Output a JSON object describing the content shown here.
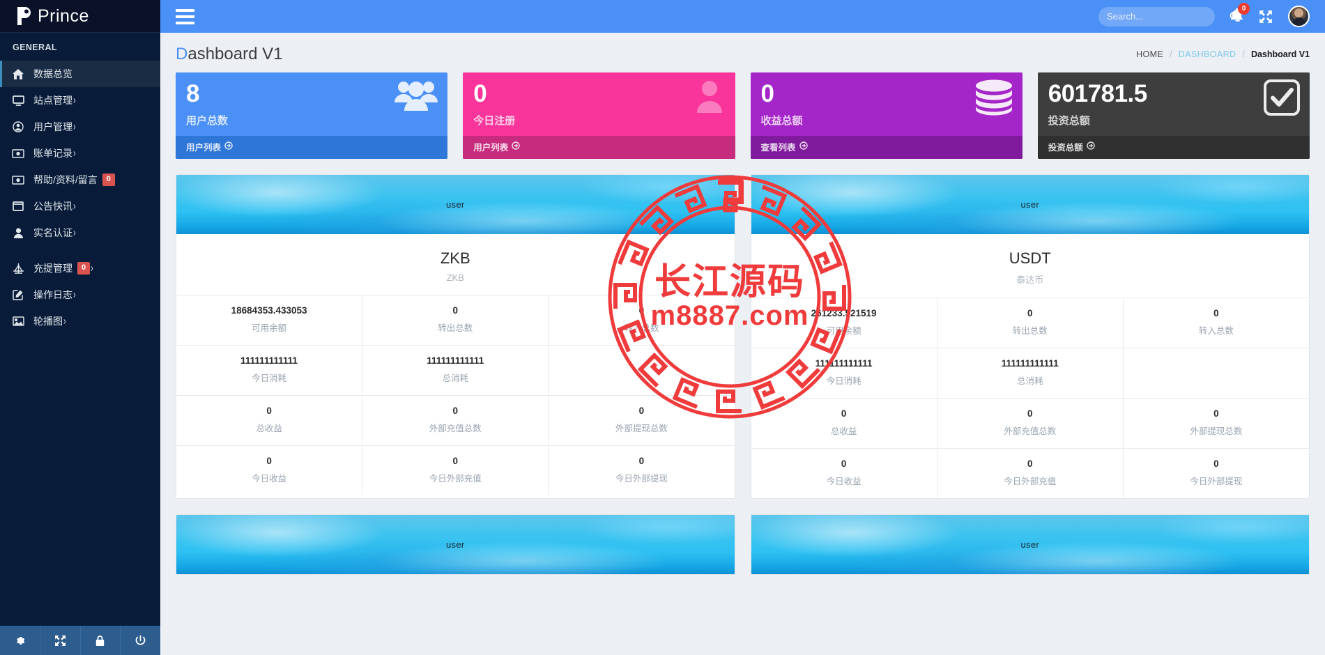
{
  "brand": {
    "name": "Prince",
    "logo_icon": "p-logo-icon"
  },
  "sidebar": {
    "section_label": "GENERAL",
    "items": [
      {
        "label": "数据总览",
        "icon": "home-icon",
        "arrow": "",
        "badge": "",
        "active": true
      },
      {
        "label": "站点管理",
        "icon": "monitor-icon",
        "arrow": "›",
        "badge": "",
        "active": false
      },
      {
        "label": "用户管理",
        "icon": "user-circle-icon",
        "arrow": "›",
        "badge": "",
        "active": false
      },
      {
        "label": "账单记录",
        "icon": "money-icon",
        "arrow": "›",
        "badge": "",
        "active": false
      },
      {
        "label": "帮助/资料/留言",
        "icon": "money-icon",
        "arrow": "",
        "badge": "0",
        "active": false
      },
      {
        "label": "公告快讯",
        "icon": "window-icon",
        "arrow": "›",
        "badge": "",
        "active": false
      },
      {
        "label": "实名认证",
        "icon": "person-icon",
        "arrow": "›",
        "badge": "",
        "active": false
      },
      {
        "label": "充提管理",
        "icon": "balance-scale-icon",
        "arrow": "›",
        "badge": "0",
        "active": false
      },
      {
        "label": "操作日志",
        "icon": "edit-square-icon",
        "arrow": "›",
        "badge": "",
        "active": false
      },
      {
        "label": "轮播图",
        "icon": "image-icon",
        "arrow": "›",
        "badge": "",
        "active": false
      }
    ],
    "footer_icons": [
      "gear-icon",
      "expand-arrows-icon",
      "lock-icon",
      "power-icon"
    ]
  },
  "header": {
    "menu_icon": "hamburger-icon",
    "search": {
      "placeholder": "Search...",
      "value": "",
      "icon": "search-icon"
    },
    "bell": {
      "icon": "bell-icon",
      "badge": "0"
    },
    "fullscreen_icon": "expand-arrows-icon",
    "avatar": "user-avatar"
  },
  "page": {
    "title_first": "D",
    "title_rest": "ashboard V1",
    "breadcrumb": {
      "home": "HOME",
      "sep": "/",
      "link": "DASHBOARD",
      "current": "Dashboard V1"
    }
  },
  "stat_cards": [
    {
      "value": "8",
      "label": "用户总数",
      "footer": "用户列表",
      "icon": "users-icon",
      "color": "#4a90f7",
      "theme": "blue",
      "footer_icon": "arrow-circle-right-icon"
    },
    {
      "value": "0",
      "label": "今日注册",
      "footer": "用户列表",
      "icon": "user-icon",
      "color": "#f9359b",
      "theme": "pink",
      "footer_icon": "arrow-circle-right-icon"
    },
    {
      "value": "0",
      "label": "收益总额",
      "footer": "查看列表",
      "icon": "database-icon",
      "color": "#a425c8",
      "theme": "purple",
      "footer_icon": "arrow-circle-right-icon"
    },
    {
      "value": "601781.5",
      "label": "投资总额",
      "footer": "投资总额",
      "icon": "check-square-icon",
      "color": "#3e3e3e",
      "theme": "dark",
      "footer_icon": "arrow-circle-right-icon"
    }
  ],
  "coin_panels": [
    {
      "banner_text": "user",
      "title": "ZKB",
      "subtitle": "ZKB",
      "rows": [
        [
          {
            "value": "18684353.433053",
            "label": "可用余额"
          },
          {
            "value": "0",
            "label": "转出总数"
          },
          {
            "value": "0",
            "label": "转入总数"
          }
        ],
        [
          {
            "value": "111111111111",
            "label": "今日消耗"
          },
          {
            "value": "111111111111",
            "label": "总消耗"
          },
          {
            "value": "",
            "label": ""
          }
        ],
        [
          {
            "value": "0",
            "label": "总收益"
          },
          {
            "value": "0",
            "label": "外部充值总数"
          },
          {
            "value": "0",
            "label": "外部提现总数"
          }
        ],
        [
          {
            "value": "0",
            "label": "今日收益"
          },
          {
            "value": "0",
            "label": "今日外部充值"
          },
          {
            "value": "0",
            "label": "今日外部提现"
          }
        ]
      ]
    },
    {
      "banner_text": "user",
      "title": "USDT",
      "subtitle": "泰达币",
      "rows": [
        [
          {
            "value": "261233.521519",
            "label": "可用余额"
          },
          {
            "value": "0",
            "label": "转出总数"
          },
          {
            "value": "0",
            "label": "转入总数"
          }
        ],
        [
          {
            "value": "111111111111",
            "label": "今日消耗"
          },
          {
            "value": "111111111111",
            "label": "总消耗"
          },
          {
            "value": "",
            "label": ""
          }
        ],
        [
          {
            "value": "0",
            "label": "总收益"
          },
          {
            "value": "0",
            "label": "外部充值总数"
          },
          {
            "value": "0",
            "label": "外部提现总数"
          }
        ],
        [
          {
            "value": "0",
            "label": "今日收益"
          },
          {
            "value": "0",
            "label": "今日外部充值"
          },
          {
            "value": "0",
            "label": "今日外部提现"
          }
        ]
      ]
    },
    {
      "banner_text": "user",
      "title": "",
      "subtitle": "",
      "rows": []
    },
    {
      "banner_text": "user",
      "title": "",
      "subtitle": "",
      "rows": []
    }
  ],
  "watermark": {
    "cn": "长江源码",
    "en": "m8887.com",
    "color": "#ef3b3b"
  }
}
